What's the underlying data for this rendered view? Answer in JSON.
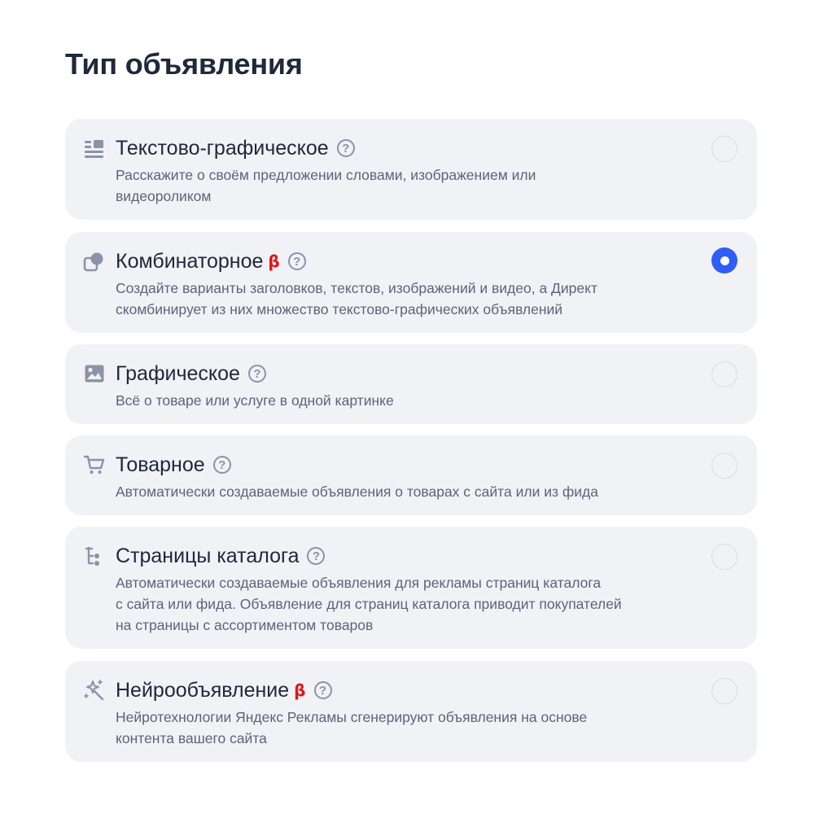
{
  "page": {
    "title": "Тип объявления"
  },
  "colors": {
    "card_bg": "#f1f2f6",
    "accent": "#2f5df6",
    "beta": "#e0151b",
    "icon": "#8c93a6",
    "text": "#20283a",
    "muted": "#5d6477"
  },
  "options": [
    {
      "icon": "text-lines-icon",
      "title": "Текстово-графическое",
      "beta": "",
      "help": "?",
      "desc_lines": [
        "Расскажите о своём предложении словами, изображением или",
        "видеороликом"
      ],
      "selected": false
    },
    {
      "icon": "combine-shapes-icon",
      "title": "Комбинаторное",
      "beta": "β",
      "help": "?",
      "desc_lines": [
        "Создайте варианты заголовков, текстов, изображений и видео, а Директ",
        "скомбинирует из них множество текстово-графических объявлений"
      ],
      "selected": true
    },
    {
      "icon": "image-icon",
      "title": "Графическое",
      "beta": "",
      "help": "?",
      "desc_lines": [
        "Всё о товаре или услуге в одной картинке"
      ],
      "selected": false
    },
    {
      "icon": "cart-icon",
      "title": "Товарное",
      "beta": "",
      "help": "?",
      "desc_lines": [
        "Автоматически создаваемые объявления о товарах с сайта или из фида"
      ],
      "selected": false
    },
    {
      "icon": "catalog-tree-icon",
      "title": "Страницы каталога",
      "beta": "",
      "help": "?",
      "desc_lines": [
        "Автоматически создаваемые объявления для рекламы страниц каталога",
        "с сайта или фида. Объявление для страниц каталога приводит покупателей",
        "на страницы с ассортиментом товаров"
      ],
      "selected": false
    },
    {
      "icon": "sparkle-magic-icon",
      "title": "Нейрообъявление",
      "beta": "β",
      "help": "?",
      "desc_lines": [
        "Нейротехнологии Яндекс Рекламы сгенерируют объявления на основе",
        "контента вашего сайта"
      ],
      "selected": false
    }
  ]
}
